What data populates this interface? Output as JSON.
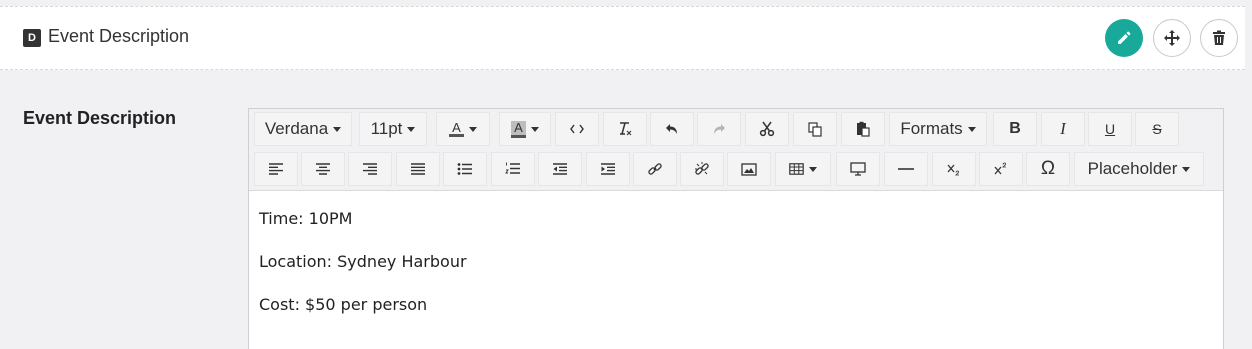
{
  "header": {
    "badge": "D",
    "title": "Event Description"
  },
  "actions": {
    "edit_icon": "pencil-icon",
    "move_icon": "move-icon",
    "delete_icon": "trash-icon",
    "accent": "#19a99a"
  },
  "field": {
    "label": "Event Description"
  },
  "toolbar": {
    "font_family": "Verdana",
    "font_size": "11pt",
    "formats_label": "Formats",
    "placeholder_label": "Placeholder",
    "text_color_glyph": "A",
    "bg_color_glyph": "A",
    "bold_glyph": "B",
    "italic_glyph": "I",
    "underline_glyph": "U",
    "strike_glyph": "S",
    "omega_glyph": "Ω"
  },
  "content": {
    "lines": [
      "Time: 10PM",
      "Location: Sydney Harbour",
      "Cost: $50 per person"
    ]
  }
}
